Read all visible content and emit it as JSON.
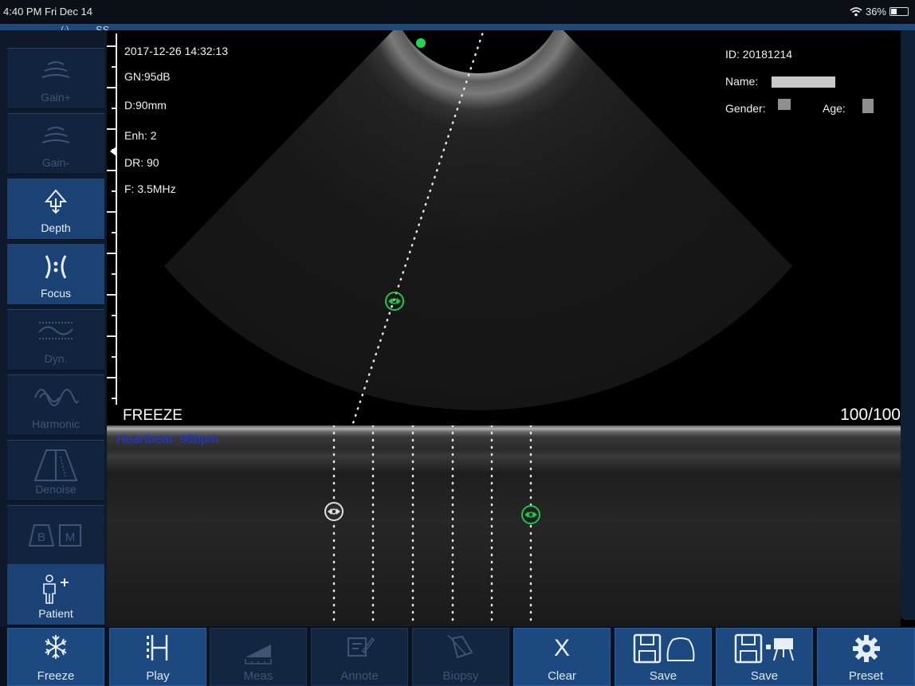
{
  "status_bar": {
    "time_date": "4:40 PM  Fri Dec 14",
    "battery_text": "36%",
    "battery_level": 0.36
  },
  "connection": {
    "wifi_symbol": "(ₗ)",
    "ssid_partial": "SS"
  },
  "image_info": {
    "datetime": "2017-12-26 14:32:13",
    "gain": "GN:95dB",
    "depth": "D:90mm",
    "enhance": "Enh: 2",
    "dynamic_range": "DR: 90",
    "frequency": "F: 3.5MHz"
  },
  "patient_info": {
    "id": "ID: 20181214",
    "name_label": "Name:",
    "gender_label": "Gender:",
    "age_label": "Age:"
  },
  "overlay": {
    "freeze_text": "FREEZE",
    "frame_count": "100/100",
    "heartbeat": "Heartbeat: 96bpm"
  },
  "sidebar": {
    "items": [
      {
        "label": "Gain+",
        "icon": "gain-up-icon"
      },
      {
        "label": "Gain-",
        "icon": "gain-down-icon"
      },
      {
        "label": "Depth",
        "icon": "depth-icon"
      },
      {
        "label": "Focus",
        "icon": "focus-icon"
      },
      {
        "label": "Dyn.",
        "icon": "dynamic-icon"
      },
      {
        "label": "Harmonic",
        "icon": "harmonic-icon"
      },
      {
        "label": "Denoise",
        "icon": "denoise-icon"
      },
      {
        "label": "",
        "icon": "bm-mode-icon",
        "b": "B",
        "m": "M"
      },
      {
        "label": "Patient",
        "icon": "patient-icon"
      }
    ]
  },
  "toolbar": {
    "freeze": "Freeze",
    "play": "Play",
    "meas": "Meas",
    "annote": "Annote",
    "biopsy": "Biopsy",
    "clear": "Clear",
    "clear_glyph": "X",
    "save_image": "Save",
    "save_video": "Save",
    "preset": "Preset"
  },
  "colors": {
    "accent": "#1c4a80",
    "marker_green": "#19c94a",
    "heartbeat_text": "#1f36e8"
  }
}
